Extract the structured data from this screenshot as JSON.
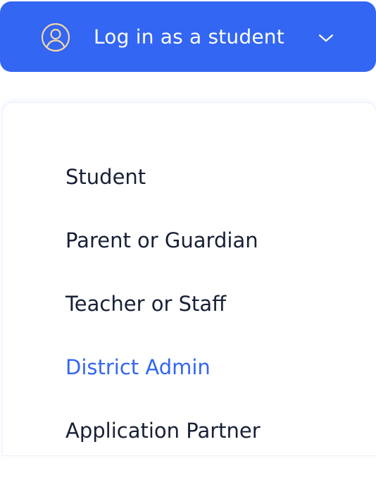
{
  "login_button": {
    "label": "Log in as a student",
    "icon": "user-circle-icon",
    "chevron": "chevron-down-icon",
    "background": "#3366f2",
    "icon_color": "#f4d8a4"
  },
  "menu": {
    "items": [
      {
        "label": "Student",
        "active": false
      },
      {
        "label": "Parent or Guardian",
        "active": false
      },
      {
        "label": "Teacher or Staff",
        "active": false
      },
      {
        "label": "District Admin",
        "active": true
      },
      {
        "label": "Application Partner",
        "active": false
      }
    ],
    "text_color": "#172036",
    "active_color": "#3366f2"
  }
}
